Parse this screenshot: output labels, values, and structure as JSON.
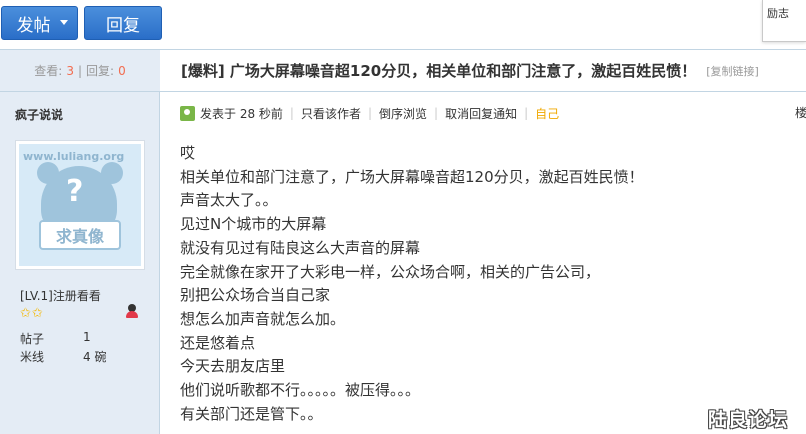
{
  "toolbar": {
    "post_label": "发帖",
    "reply_label": "回复",
    "floating_text": "励志"
  },
  "thread_stats": {
    "views_label": "查看:",
    "views": "3",
    "divider": "|",
    "replies_label": "回复:",
    "replies": "0"
  },
  "thread": {
    "title": "[爆料] 广场大屏幕噪音超120分贝，相关单位和部门注意了，激起百姓民愤！",
    "copy_link": "[复制链接]"
  },
  "author": {
    "name": "疯子说说",
    "avatar_url_text": "www.luliang.org",
    "avatar_question": "?",
    "avatar_sign": "求真像",
    "level": "[LV.1]注册看看",
    "stars": "✩✩",
    "posts_label": "帖子",
    "posts": "1",
    "rice_label": "米线",
    "rice": "4 碗"
  },
  "post_meta": {
    "posted": "发表于 28 秒前",
    "only_author": "只看该作者",
    "reverse_order": "倒序浏览",
    "cancel_notify": "取消回复通知",
    "self": "自己",
    "separator": "|",
    "floor": "楼"
  },
  "post_lines": [
    "哎",
    "相关单位和部门注意了，广场大屏幕噪音超120分贝，激起百姓民愤！",
    "声音太大了。。",
    "见过N个城市的大屏幕",
    "就没有见过有陆良这么大声音的屏幕",
    "完全就像在家开了大彩电一样，公众场合啊，相关的广告公司，",
    "别把公众场合当自己家",
    "想怎么加声音就怎么加。",
    "还是悠着点",
    "今天去朋友店里",
    "他们说听歌都不行。。。。。被压得。。。",
    "有关部门还是管下。。"
  ],
  "watermark": "陆良论坛",
  "colors": {
    "button": "#2a6ec8",
    "sidebar_bg": "#e4ecf5",
    "border": "#c2d5e3",
    "stat_number": "#f26c4f",
    "self_link": "#f0a800",
    "star": "#f5b800"
  }
}
